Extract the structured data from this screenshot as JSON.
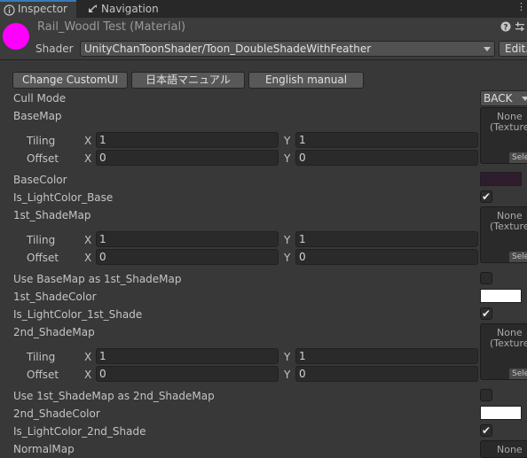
{
  "tabs": [
    {
      "label": "Inspector",
      "icon": "info-icon",
      "active": true
    },
    {
      "label": "Navigation",
      "icon": "navigation-icon",
      "active": false
    }
  ],
  "header": {
    "material_name": "Rail_Woodl Test (Material)",
    "material_color": "#ff00ff",
    "shader_label": "Shader",
    "shader_value": "UnityChanToonShader/Toon_DoubleShadeWithFeather",
    "edit_label": "Edit..."
  },
  "buttons": {
    "custom_ui": "Change CustomUI",
    "japanese_manual": "日本語マニュアル",
    "english_manual": "English manual"
  },
  "properties": {
    "cull_mode": {
      "label": "Cull Mode",
      "value": "BACK"
    },
    "base_map": {
      "label": "BaseMap",
      "texture_line1": "None",
      "texture_line2": "(Texture)",
      "select": "Selec",
      "tiling_label": "Tiling",
      "offset_label": "Offset",
      "tiling_x": "1",
      "tiling_y": "1",
      "offset_x": "0",
      "offset_y": "0"
    },
    "base_color": {
      "label": "BaseColor",
      "color": "#2e1d2c"
    },
    "is_light_color_base": {
      "label": "Is_LightColor_Base",
      "checked": true
    },
    "first_shade_map": {
      "label": "1st_ShadeMap",
      "texture_line1": "None",
      "texture_line2": "(Texture)",
      "select": "Selec",
      "tiling_label": "Tiling",
      "offset_label": "Offset",
      "tiling_x": "1",
      "tiling_y": "1",
      "offset_x": "0",
      "offset_y": "0"
    },
    "use_basemap_as_1st": {
      "label": "Use BaseMap as 1st_ShadeMap",
      "checked": false
    },
    "first_shade_color": {
      "label": "1st_ShadeColor",
      "color": "#ffffff"
    },
    "is_light_color_1st": {
      "label": "Is_LightColor_1st_Shade",
      "checked": true
    },
    "second_shade_map": {
      "label": "2nd_ShadeMap",
      "texture_line1": "None",
      "texture_line2": "(Texture)",
      "select": "Selec",
      "tiling_label": "Tiling",
      "offset_label": "Offset",
      "tiling_x": "1",
      "tiling_y": "1",
      "offset_x": "0",
      "offset_y": "0"
    },
    "use_1st_as_2nd": {
      "label": "Use 1st_ShadeMap as 2nd_ShadeMap",
      "checked": false
    },
    "second_shade_color": {
      "label": "2nd_ShadeColor",
      "color": "#ffffff"
    },
    "is_light_color_2nd": {
      "label": "Is_LightColor_2nd_Shade",
      "checked": true
    },
    "normal_map": {
      "label": "NormalMap",
      "texture_line1": "None"
    }
  },
  "axis_labels": {
    "x": "X",
    "y": "Y"
  },
  "check_glyph": "✔",
  "icons": {
    "help": "help-icon",
    "preset": "preset-icon",
    "menu": "menu-icon",
    "tab_menu": "tab-menu-icon",
    "color_picker": "eyedropper-icon"
  }
}
